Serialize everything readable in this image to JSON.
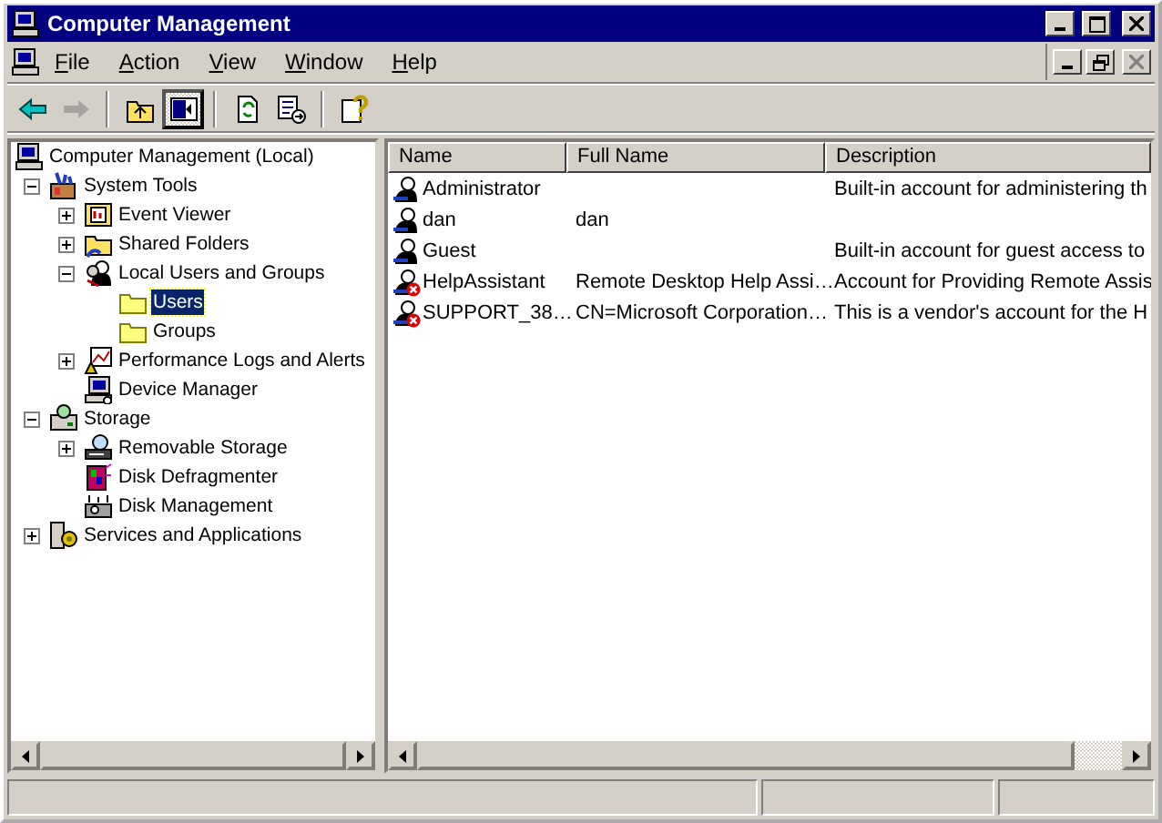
{
  "window": {
    "title": "Computer Management"
  },
  "menu": [
    {
      "label": "File"
    },
    {
      "label": "Action"
    },
    {
      "label": "View"
    },
    {
      "label": "Window"
    },
    {
      "label": "Help"
    }
  ],
  "toolbar": [
    {
      "kind": "back",
      "disabled": false,
      "pressed": false
    },
    {
      "kind": "forward",
      "disabled": true,
      "pressed": false
    },
    {
      "kind": "separator"
    },
    {
      "kind": "up",
      "disabled": false,
      "pressed": false
    },
    {
      "kind": "tree",
      "disabled": false,
      "pressed": true
    },
    {
      "kind": "separator"
    },
    {
      "kind": "refresh",
      "disabled": false,
      "pressed": false
    },
    {
      "kind": "export",
      "disabled": false,
      "pressed": false
    },
    {
      "kind": "separator"
    },
    {
      "kind": "help",
      "disabled": false,
      "pressed": false
    }
  ],
  "tree": [
    {
      "label": "Computer Management (Local)",
      "kind": "computer",
      "selected": false,
      "children": [
        {
          "label": "System Tools",
          "kind": "tools",
          "expanded": true,
          "selected": false,
          "children": [
            {
              "label": "Event Viewer",
              "kind": "log",
              "expanded": false,
              "selected": false
            },
            {
              "label": "Shared Folders",
              "kind": "share",
              "expanded": false,
              "selected": false
            },
            {
              "label": "Local Users and Groups",
              "kind": "users",
              "expanded": true,
              "selected": false,
              "children": [
                {
                  "label": "Users",
                  "kind": "folder",
                  "selected": true
                },
                {
                  "label": "Groups",
                  "kind": "folder",
                  "selected": false
                }
              ]
            },
            {
              "label": "Performance Logs and Alerts",
              "kind": "chart",
              "expanded": false,
              "selected": false
            },
            {
              "label": "Device Manager",
              "kind": "device",
              "selected": false
            }
          ]
        },
        {
          "label": "Storage",
          "kind": "storage",
          "expanded": true,
          "selected": false,
          "children": [
            {
              "label": "Removable Storage",
              "kind": "drive",
              "expanded": false,
              "selected": false
            },
            {
              "label": "Disk Defragmenter",
              "kind": "defrag",
              "selected": false
            },
            {
              "label": "Disk Management",
              "kind": "disk",
              "selected": false
            }
          ]
        },
        {
          "label": "Services and Applications",
          "kind": "services",
          "expanded": false,
          "selected": false
        }
      ]
    }
  ],
  "table": {
    "columns": [
      "Name",
      "Full Name",
      "Description"
    ],
    "rows": [
      {
        "name": "Administrator",
        "description": "Built-in account for administering th",
        "disabled": false
      },
      {
        "name": "dan",
        "full_name": "dan",
        "disabled": false
      },
      {
        "name": "Guest",
        "description": "Built-in account for guest access to",
        "disabled": false
      },
      {
        "name": "HelpAssistant",
        "full_name": "Remote Desktop Help Assi…",
        "description": "Account for Providing Remote Assis",
        "disabled": true
      },
      {
        "name": "SUPPORT_38…",
        "full_name": "CN=Microsoft Corporation…",
        "description": "This is a vendor's account for the H",
        "disabled": true
      }
    ]
  }
}
